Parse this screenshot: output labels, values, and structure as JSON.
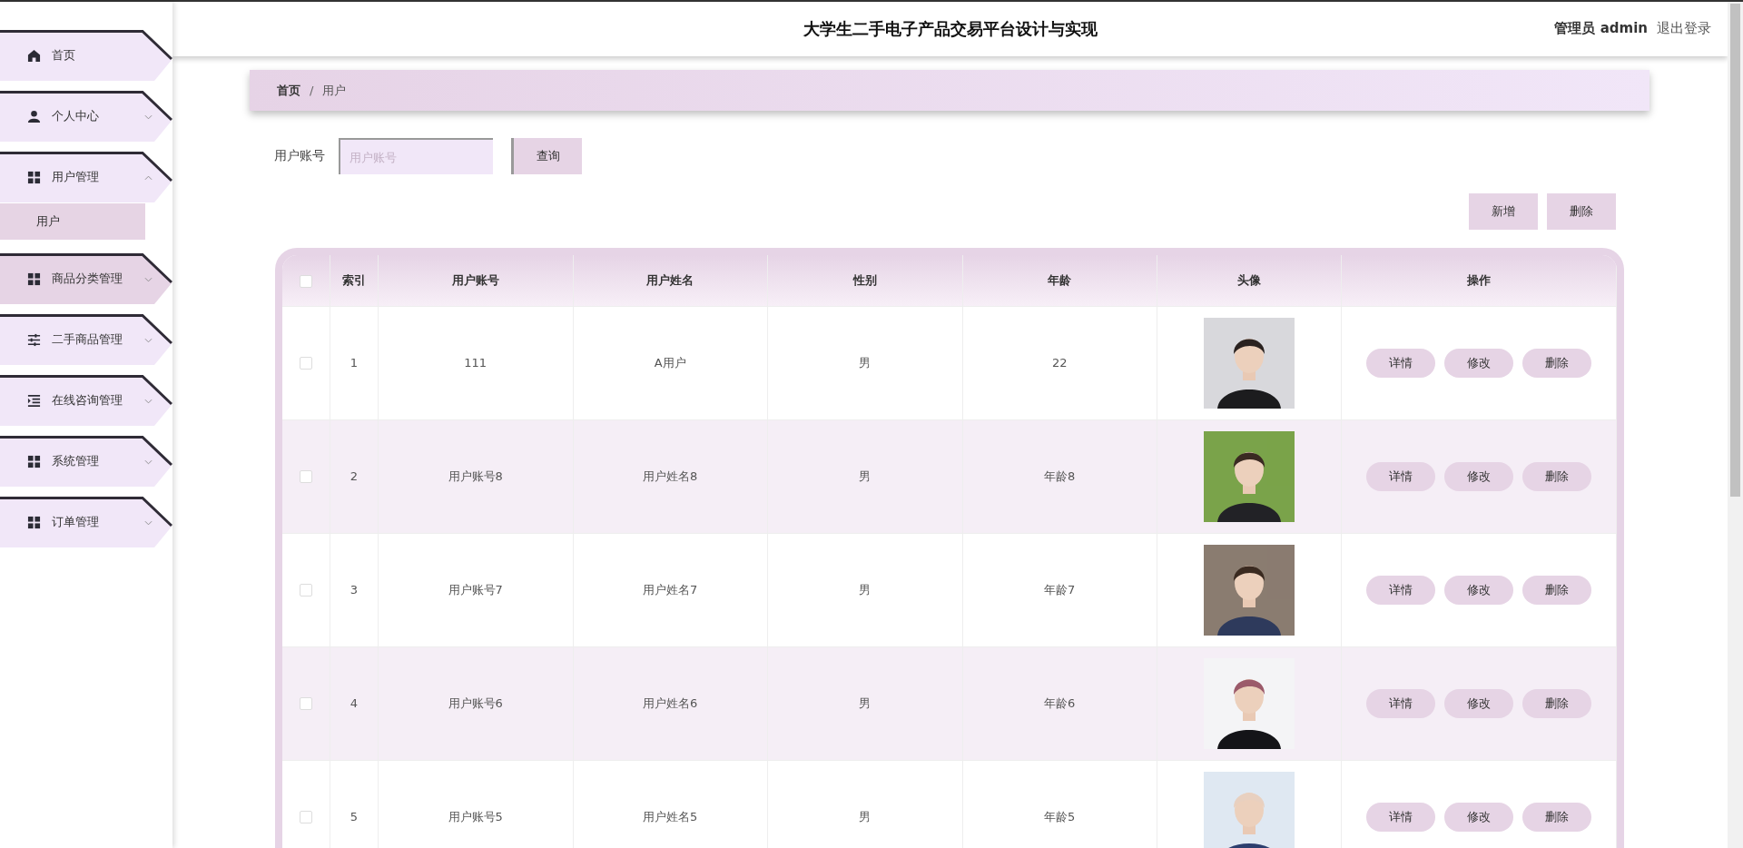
{
  "header": {
    "title": "大学生二手电子产品交易平台设计与实现",
    "user_label": "管理员 admin",
    "logout": "退出登录"
  },
  "sidebar": {
    "items": [
      {
        "label": "首页",
        "kind": "home",
        "highlighted": false
      },
      {
        "label": "个人中心",
        "kind": "person",
        "expanded": false,
        "highlighted": false
      },
      {
        "label": "用户管理",
        "kind": "grid",
        "expanded": true,
        "highlighted": false,
        "children": [
          {
            "label": "用户",
            "selected": true
          }
        ]
      },
      {
        "label": "商品分类管理",
        "kind": "grid",
        "expanded": false,
        "highlighted": true
      },
      {
        "label": "二手商品管理",
        "kind": "sliders",
        "expanded": false,
        "highlighted": false
      },
      {
        "label": "在线咨询管理",
        "kind": "list",
        "expanded": false,
        "highlighted": false
      },
      {
        "label": "系统管理",
        "kind": "grid",
        "expanded": false,
        "highlighted": false
      },
      {
        "label": "订单管理",
        "kind": "grid",
        "expanded": false,
        "highlighted": false
      }
    ]
  },
  "breadcrumb": {
    "items": [
      "首页",
      "用户"
    ],
    "separator": "/"
  },
  "search": {
    "label": "用户账号",
    "placeholder": "用户账号",
    "button": "查询"
  },
  "toolbar": [
    "新增",
    "删除"
  ],
  "table": {
    "columns": [
      "索引",
      "用户账号",
      "用户姓名",
      "性别",
      "年龄",
      "头像",
      "操作"
    ],
    "all_checked": false,
    "rows": [
      {
        "checked": false,
        "cells": [
          "1",
          "111",
          "A用户",
          "男",
          "22"
        ],
        "actions": [
          "详情",
          "修改",
          "删除"
        ]
      },
      {
        "checked": false,
        "cells": [
          "2",
          "用户账号8",
          "用户姓名8",
          "男",
          "年龄8"
        ],
        "actions": [
          "详情",
          "修改",
          "删除"
        ]
      },
      {
        "checked": false,
        "cells": [
          "3",
          "用户账号7",
          "用户姓名7",
          "男",
          "年龄7"
        ],
        "actions": [
          "详情",
          "修改",
          "删除"
        ]
      },
      {
        "checked": false,
        "cells": [
          "4",
          "用户账号6",
          "用户姓名6",
          "男",
          "年龄6"
        ],
        "actions": [
          "详情",
          "修改",
          "删除"
        ]
      },
      {
        "checked": false,
        "cells": [
          "5",
          "用户账号5",
          "用户姓名5",
          "男",
          "年龄5"
        ],
        "actions": [
          "详情",
          "修改",
          "删除"
        ]
      }
    ]
  }
}
